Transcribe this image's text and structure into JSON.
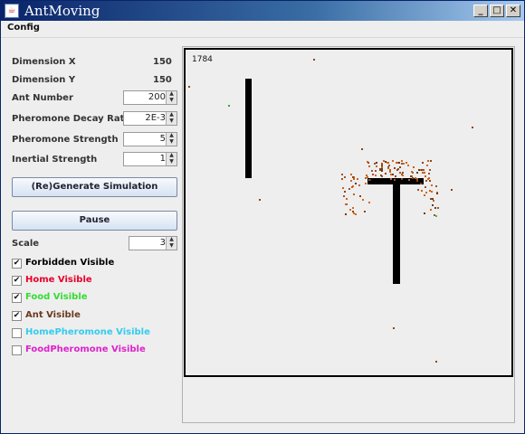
{
  "window": {
    "title": "AntMoving"
  },
  "menu": {
    "config": "Config"
  },
  "settings": {
    "dimension_x_label": "Dimension X",
    "dimension_x_value": "150",
    "dimension_y_label": "Dimension Y",
    "dimension_y_value": "150",
    "ant_number_label": "Ant Number",
    "ant_number_value": "200",
    "decay_label": "Pheromone Decay Rate",
    "decay_value": "2E-3",
    "strength_label": "Pheromone Strength",
    "strength_value": "5",
    "inertial_label": "Inertial Strength",
    "inertial_value": "1",
    "generate_button": "(Re)Generate Simulation",
    "pause_button": "Pause",
    "scale_label": "Scale",
    "scale_value": "3"
  },
  "checkboxes": [
    {
      "label": "Forbidden Visible",
      "checked": true,
      "color": "#000000"
    },
    {
      "label": "Home Visible",
      "checked": true,
      "color": "#E8002A"
    },
    {
      "label": "Food Visible",
      "checked": true,
      "color": "#33DD33"
    },
    {
      "label": "Ant Visible",
      "checked": true,
      "color": "#6B3A1E"
    },
    {
      "label": "HomePheromone Visible",
      "checked": false,
      "color": "#33CCEE"
    },
    {
      "label": "FoodPheromone Visible",
      "checked": false,
      "color": "#DD22CC"
    }
  ],
  "simulation": {
    "step_count": "1784"
  }
}
